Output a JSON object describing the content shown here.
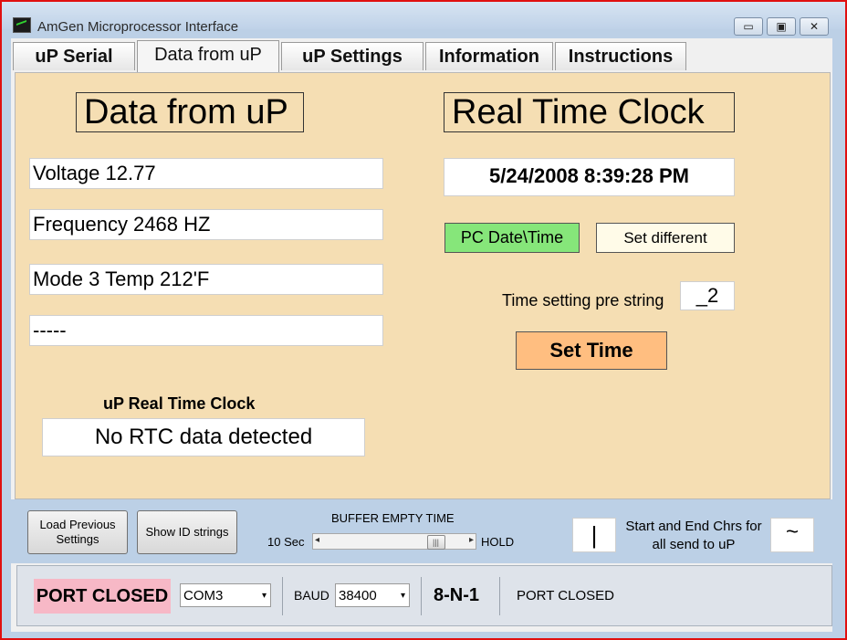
{
  "window": {
    "title": "AmGen Microprocessor Interface",
    "minimize": "▭",
    "maximize": "▣",
    "close": "✕"
  },
  "tabs": [
    "uP  Serial",
    "Data from uP",
    "uP  Settings",
    "Information",
    "Instructions"
  ],
  "data_panel": {
    "heading": "Data from uP",
    "voltage": "Voltage  12.77",
    "frequency": "Frequency  2468 HZ",
    "mode_temp": "Mode 3    Temp 212'F",
    "line4": "-----",
    "rtc_label": "uP Real Time Clock",
    "rtc_value": "No RTC data detected"
  },
  "clock_panel": {
    "heading": "Real Time Clock",
    "datetime": "5/24/2008  8:39:28 PM",
    "pc_datetime_button": "PC  Date\\Time",
    "set_different_button": "Set different",
    "pre_string_label": "Time setting pre string",
    "pre_string_value": "_2",
    "set_time_button": "Set Time"
  },
  "toolbar": {
    "load_previous": "Load Previous Settings",
    "show_id": "Show ID strings",
    "buffer_label": "BUFFER EMPTY TIME",
    "slider_min": "10 Sec",
    "slider_max": "HOLD",
    "slider_level": 0.85,
    "start_end_char": "|",
    "start_end_label": "Start and End Chrs for all send to uP",
    "tilde": "~"
  },
  "status": {
    "port_badge": "PORT CLOSED",
    "com_port": "COM3",
    "baud_label": "BAUD",
    "baud_value": "38400",
    "format": "8-N-1",
    "port_status": "PORT CLOSED"
  },
  "colors": {
    "panel": "#f5deb3",
    "green_button": "#86e67a",
    "orange_button": "#ffbe80",
    "badge": "#f7b8c6"
  }
}
